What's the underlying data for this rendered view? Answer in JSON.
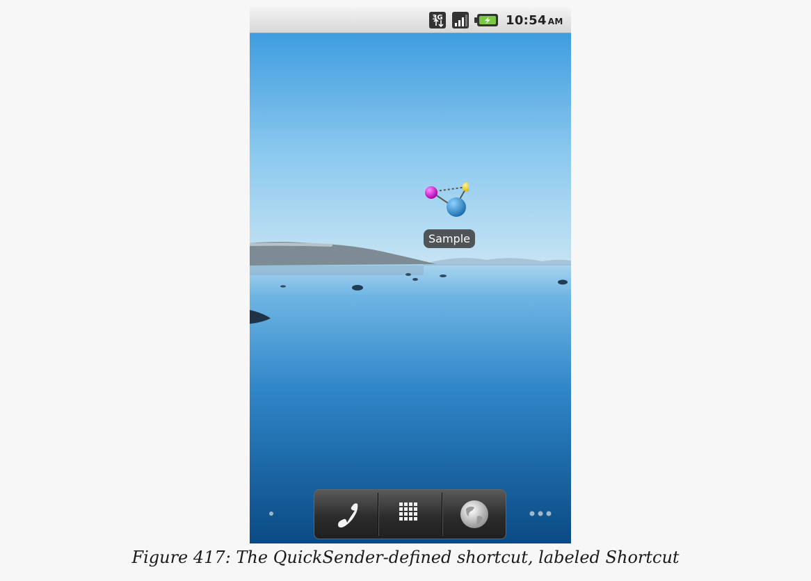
{
  "status_bar": {
    "network_label": "3G",
    "time": "10:54",
    "ampm": "AM",
    "icons": [
      "network-3g-icon",
      "signal-strength-icon",
      "battery-charging-icon"
    ]
  },
  "home": {
    "shortcut_label": "Sample",
    "dock": {
      "items": [
        "phone-icon",
        "app-drawer-icon",
        "browser-globe-icon"
      ]
    }
  },
  "caption": "Figure 417: The QuickSender-defined shortcut, labeled Shortcut",
  "colors": {
    "page_background": "#f7f7f7",
    "sky_top": "#4aa3df",
    "water_bottom": "#0d4f8c"
  }
}
